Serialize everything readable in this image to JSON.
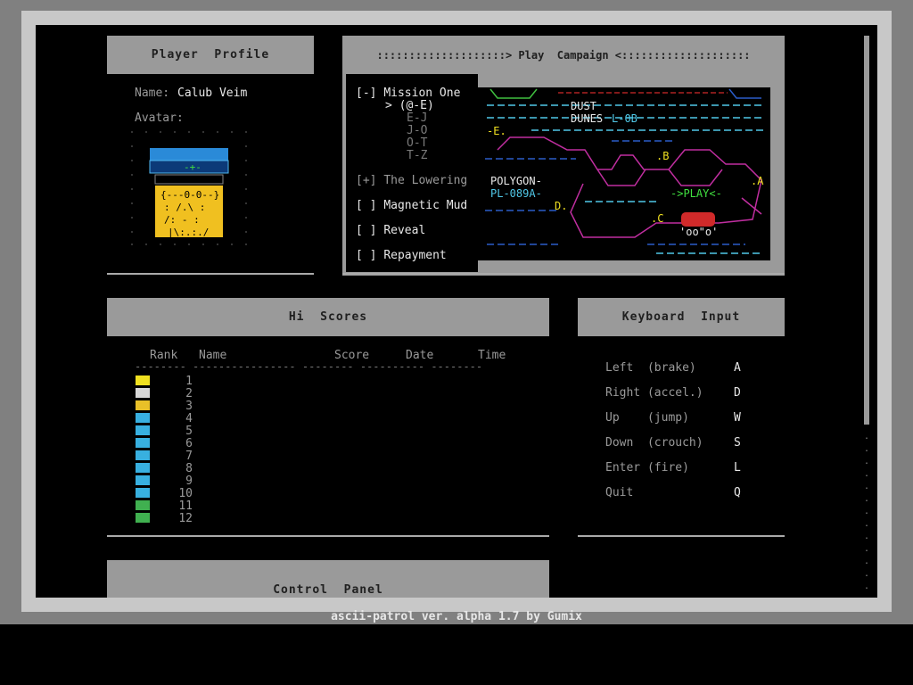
{
  "footer": "ascii-patrol ver. alpha 1.7 by Gumix",
  "profile": {
    "header": "Player  Profile",
    "name_label": "Name:",
    "name_value": "Calub Veim",
    "avatar_label": "Avatar:"
  },
  "campaign": {
    "header": "::::::::::::::::::::> Play  Campaign <::::::::::::::::::::",
    "missions": [
      {
        "marker": "[-]",
        "label": "Mission One",
        "state": "expanded"
      },
      {
        "marker": "[+]",
        "label": "The Lowering",
        "state": "collapsed"
      },
      {
        "marker": "[ ]",
        "label": "Magnetic Mud",
        "state": "locked"
      },
      {
        "marker": "[ ]",
        "label": "Reveal",
        "state": "locked"
      },
      {
        "marker": "[ ]",
        "label": "Repayment",
        "state": "locked"
      }
    ],
    "sub_items": [
      {
        "label": "> (@-E)",
        "selected": true
      },
      {
        "label": "E-J",
        "selected": false
      },
      {
        "label": "J-O",
        "selected": false
      },
      {
        "label": "O-T",
        "selected": false
      },
      {
        "label": "T-Z",
        "selected": false
      }
    ],
    "map_labels": {
      "dust": "DUST",
      "dunes": "DUNES",
      "dunes_code": "L-0B",
      "polygon": "POLYGON-",
      "polygon_code": "PL-089A-",
      "play": "->PLAY<-",
      "a": ".A",
      "b": ".B",
      "c": ".C",
      "d": "D.",
      "e": "-E."
    }
  },
  "hiscores": {
    "header": "Hi  Scores",
    "columns": [
      "Rank",
      "Name",
      "Score",
      "Date",
      "Time"
    ],
    "divider": "-------- ---------------- -------- ---------- --------",
    "rows": [
      {
        "rank": "1",
        "color": "#f0e020"
      },
      {
        "rank": "2",
        "color": "#d8d8d8"
      },
      {
        "rank": "3",
        "color": "#e8c028"
      },
      {
        "rank": "4",
        "color": "#38b0e0"
      },
      {
        "rank": "5",
        "color": "#38b0e0"
      },
      {
        "rank": "6",
        "color": "#38b0e0"
      },
      {
        "rank": "7",
        "color": "#38b0e0"
      },
      {
        "rank": "8",
        "color": "#38b0e0"
      },
      {
        "rank": "9",
        "color": "#38b0e0"
      },
      {
        "rank": "10",
        "color": "#38b0e0"
      },
      {
        "rank": "11",
        "color": "#40b050"
      },
      {
        "rank": "12",
        "color": "#40b050"
      }
    ]
  },
  "keyboard": {
    "header": "Keyboard  Input",
    "bindings": [
      {
        "action": "Left  (brake)",
        "key": "A"
      },
      {
        "action": "Right (accel.)",
        "key": "D"
      },
      {
        "action": "Up    (jump)",
        "key": "W"
      },
      {
        "action": "Down  (crouch)",
        "key": "S"
      },
      {
        "action": "Enter (fire)",
        "key": "L"
      },
      {
        "action": "Quit",
        "key": "Q"
      }
    ]
  },
  "control_panel": {
    "header": "Control  Panel"
  },
  "colors": {
    "panel_header": "#9a9a9a",
    "map_pink": "#c02ea0",
    "map_blue": "#2a5cc8",
    "map_cyan": "#50c8e8",
    "map_green": "#40e040",
    "map_red": "#d02a2a",
    "map_yellow": "#f0e020"
  }
}
